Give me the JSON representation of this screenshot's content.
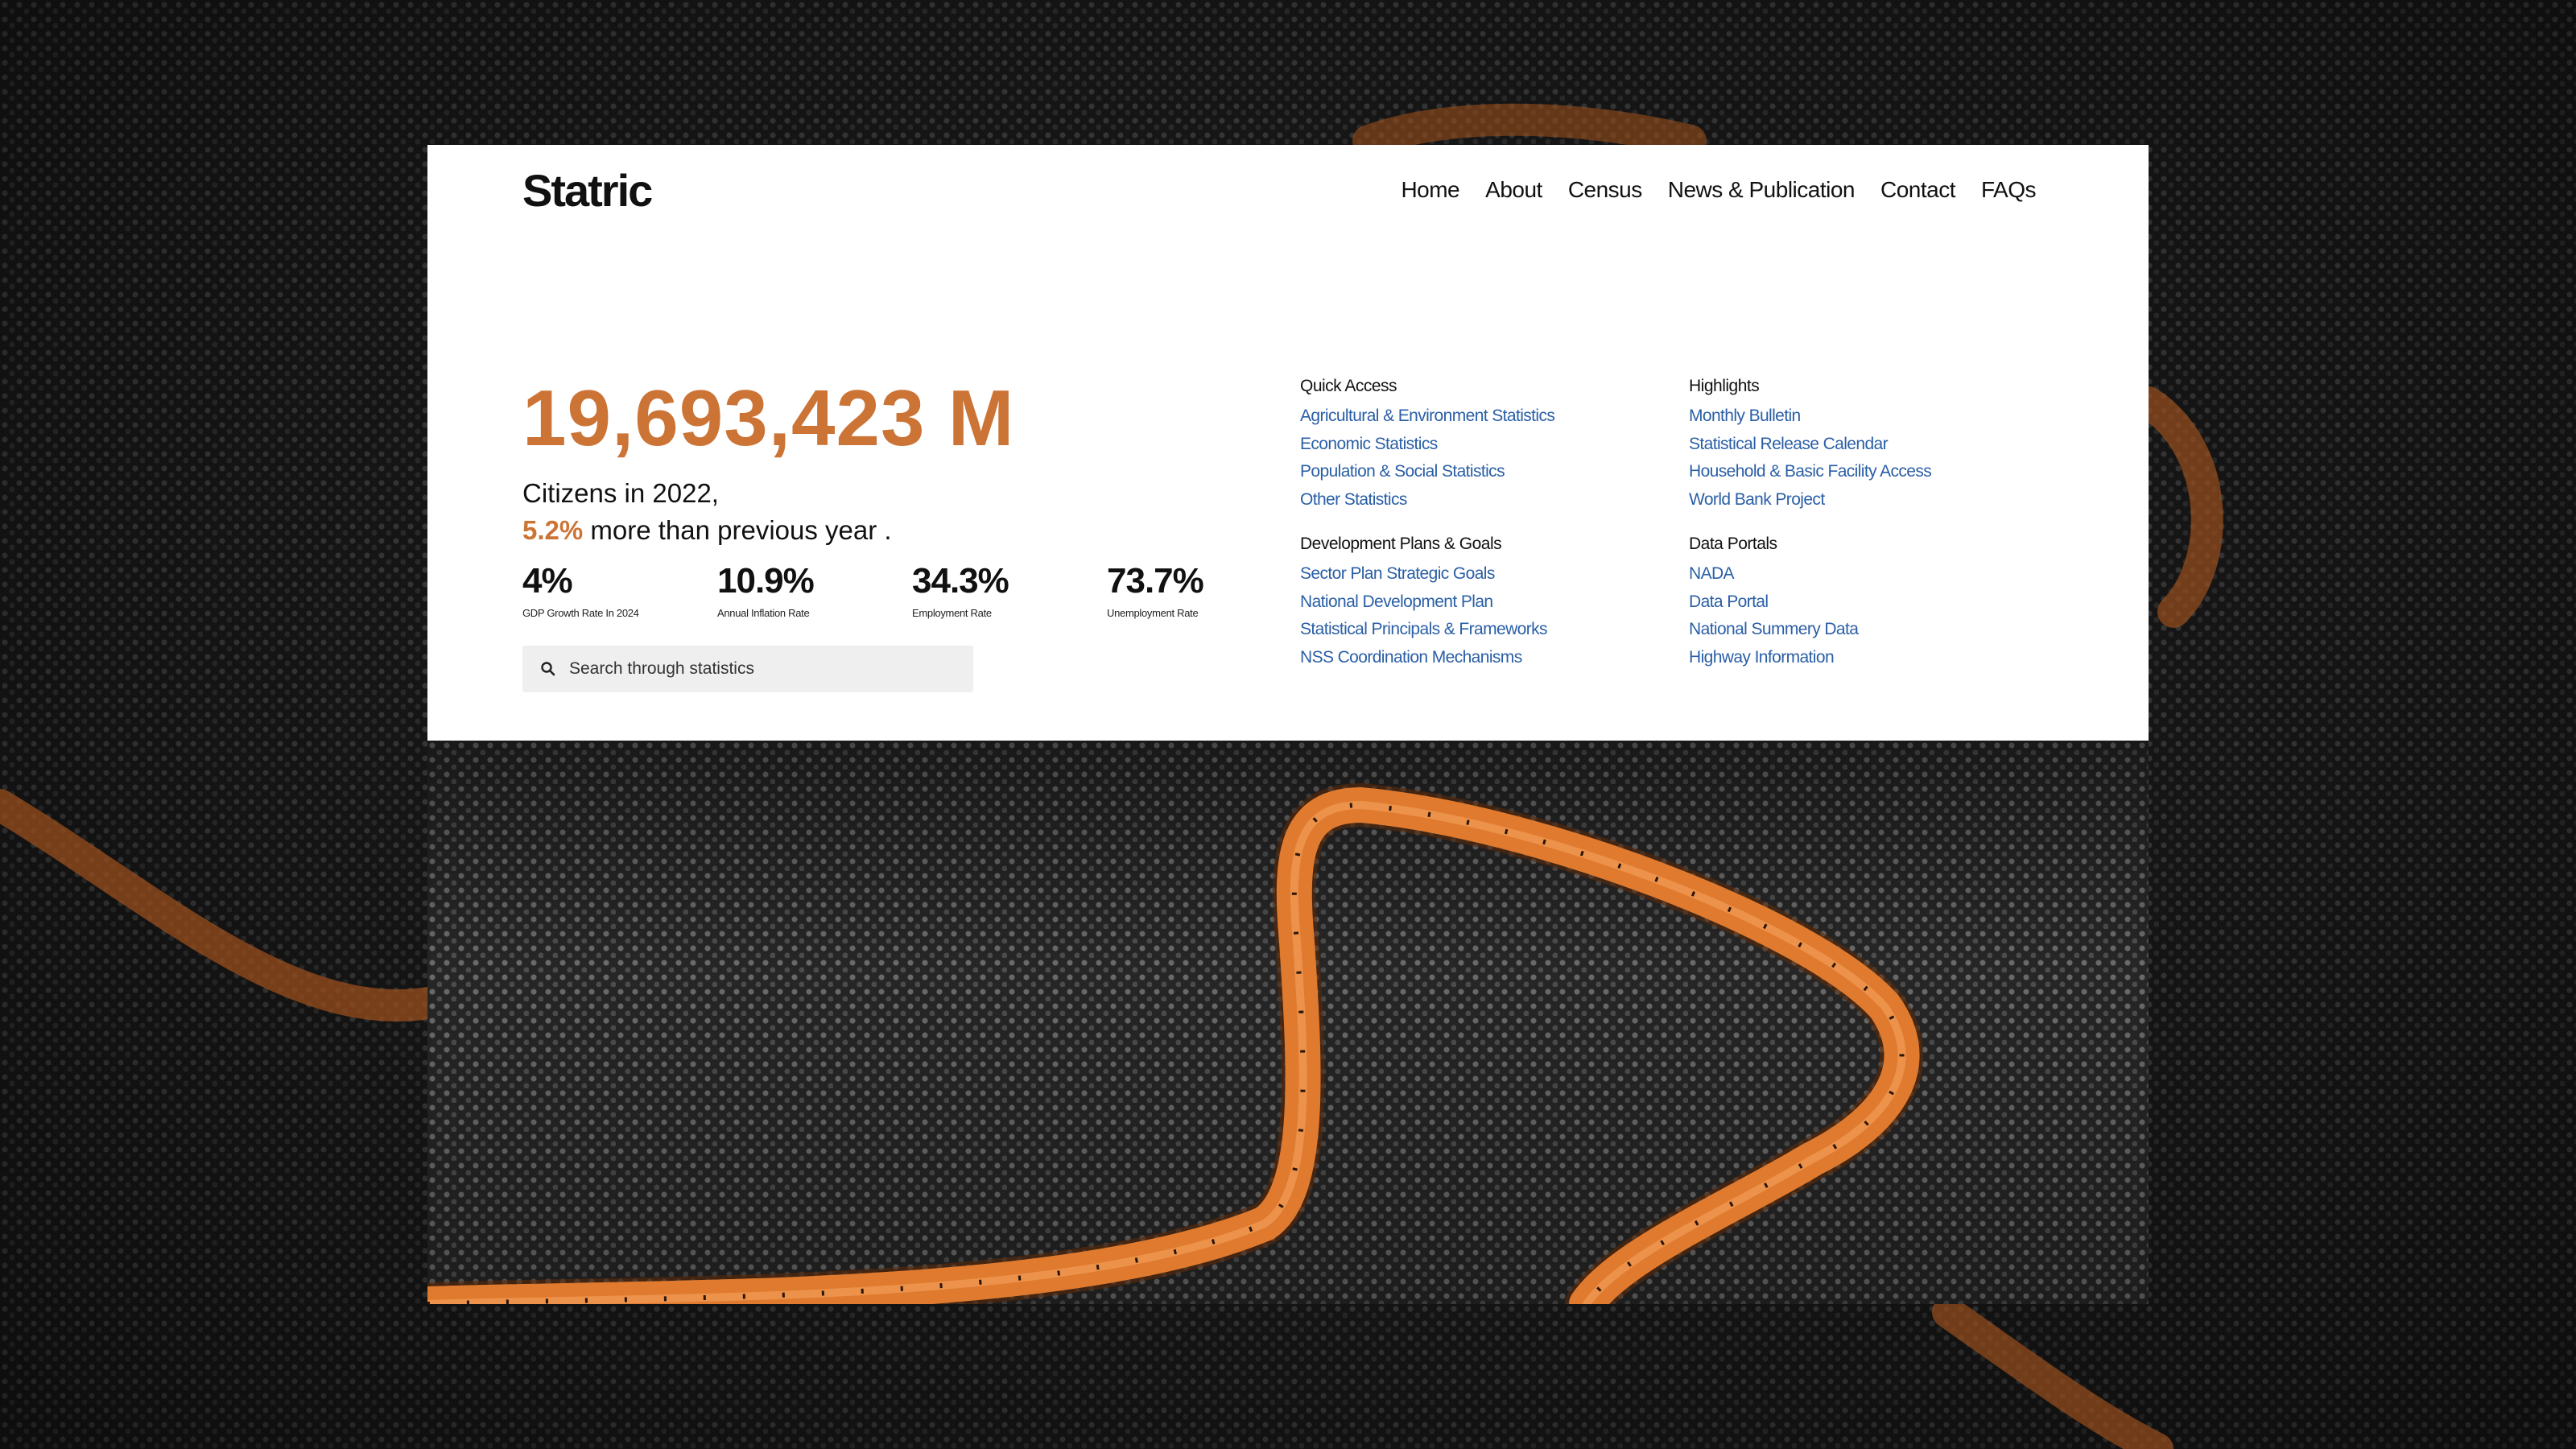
{
  "brand": {
    "logo": "Statric",
    "accent": "#cc7436",
    "link_color": "#2a5fa6"
  },
  "nav": [
    {
      "label": "Home"
    },
    {
      "label": "About"
    },
    {
      "label": "Census"
    },
    {
      "label": "News & Publication"
    },
    {
      "label": "Contact"
    },
    {
      "label": "FAQs"
    }
  ],
  "hero": {
    "population": "19,693,423 M",
    "line1": "Citizens in 2022,",
    "growth": "5.2%",
    "line2_rest": " more than previous year ."
  },
  "stats": [
    {
      "value": "4%",
      "label": "GDP Growth Rate In 2024"
    },
    {
      "value": "10.9%",
      "label": "Annual Inflation Rate"
    },
    {
      "value": "34.3%",
      "label": "Employment Rate"
    },
    {
      "value": "73.7%",
      "label": "Unemployment Rate"
    }
  ],
  "search": {
    "placeholder": "Search through statistics",
    "icon": "search-icon"
  },
  "link_groups": {
    "quick_access": {
      "title": "Quick Access",
      "links": [
        "Agricultural & Environment Statistics",
        "Economic Statistics",
        "Population & Social Statistics",
        "Other Statistics"
      ]
    },
    "development": {
      "title": "Development Plans & Goals",
      "links": [
        "Sector Plan Strategic Goals",
        "National Development Plan",
        "Statistical Principals & Frameworks",
        "NSS Coordination Mechanisms"
      ]
    },
    "highlights": {
      "title": "Highlights",
      "links": [
        "Monthly Bulletin",
        "Statistical Release Calendar",
        "Household & Basic Facility Access",
        "World Bank Project"
      ]
    },
    "data_portals": {
      "title": "Data Portals",
      "links": [
        "NADA",
        "Data Portal",
        "National Summery Data",
        "Highway Information"
      ]
    }
  }
}
